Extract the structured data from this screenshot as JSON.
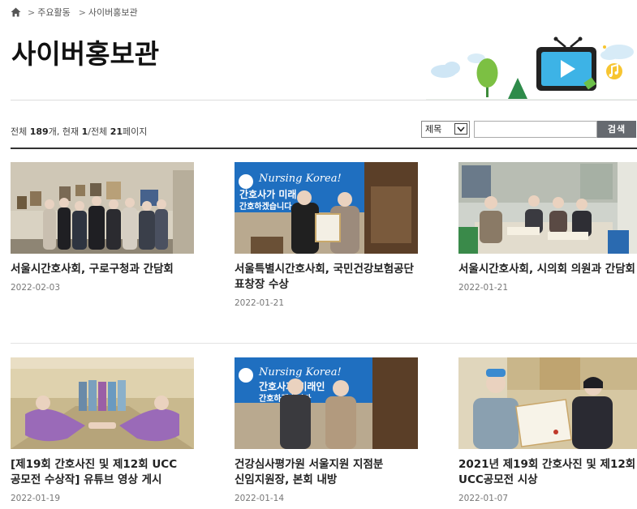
{
  "breadcrumb": {
    "sep": ">",
    "items": [
      "주요활동",
      "사이버홍보관"
    ]
  },
  "page": {
    "title": "사이버홍보관"
  },
  "summary": {
    "total_label": "전체",
    "total_count": "189",
    "count_unit": "개, 현재",
    "current_page": "1",
    "page_sep": "/전체",
    "total_pages": "21",
    "page_unit": "페이지"
  },
  "search": {
    "field_selected": "제목",
    "query": "",
    "button_label": "검색"
  },
  "posts": [
    {
      "title": "서울시간호사회, 구로구청과 간담회",
      "date": "2022-02-03",
      "thumb": "photo-group-meeting"
    },
    {
      "title": "서울특별시간호사회, 국민건강보험공단 표창장 수상",
      "date": "2022-01-21",
      "thumb": "photo-award-certificate"
    },
    {
      "title": "서울시간호사회, 시의회 의원과 간담회",
      "date": "2022-01-21",
      "thumb": "photo-conference-table"
    },
    {
      "title": "[제19회 간호사진 및 제12회 UCC 공모전 수상작] 유튜브 영상 게시",
      "date": "2022-01-19",
      "thumb": "photo-nurses-hallway"
    },
    {
      "title": "건강심사평가원 서울지원 지점분 신임지원장, 본회 내방",
      "date": "2022-01-14",
      "thumb": "photo-visit-banner"
    },
    {
      "title": "2021년 제19회 간호사진 및 제12회 UCC공모전 시상",
      "date": "2022-01-07",
      "thumb": "photo-prize-ceremony"
    }
  ],
  "photo_text": {
    "banner_script": "Nursing Korea!",
    "banner_line1": "간호사가 미래",
    "banner_line2": "간호하겠습니다",
    "banner2_line1": "간호사가 미래인",
    "banner2_line2": "간호하겠습니다"
  },
  "colors": {
    "accent_dark": "#333333",
    "button_bg": "#666a70",
    "banner_blue": "#1f6fc0"
  }
}
